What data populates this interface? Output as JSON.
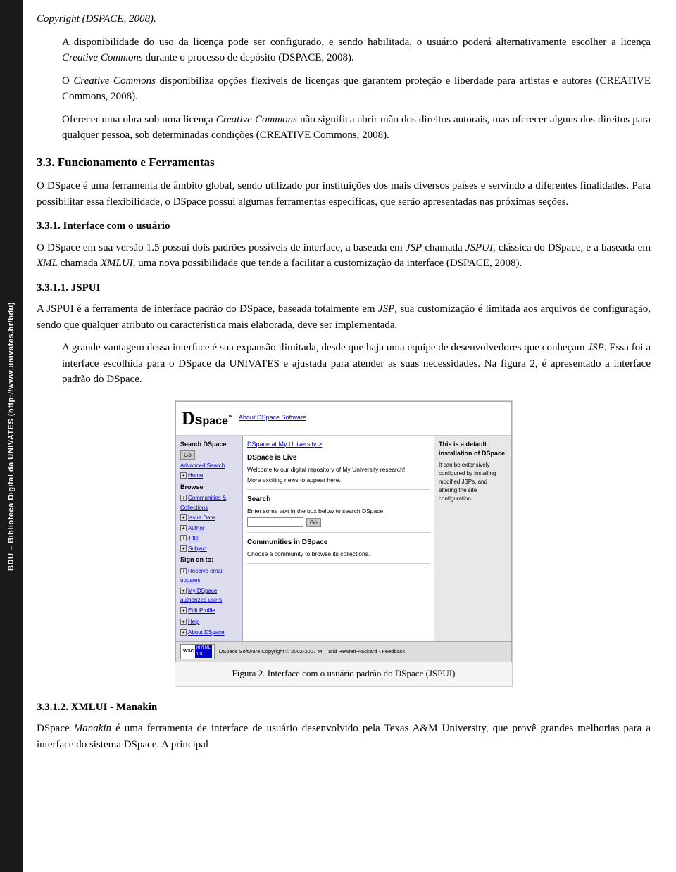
{
  "sidebar": {
    "text": "BDU – Biblioteca Digital da UNIVATES (http://www.univates.br/bdu)"
  },
  "content": {
    "copyright_line": "Copyright (DSPACE, 2008).",
    "paragraph1": "A disponibilidade do uso da licença pode ser configurado, e sendo habilitada, o usuário poderá alternativamente escolher a licença Creative Commons durante o processo de depósito (DSPACE, 2008).",
    "paragraph2": "O Creative Commons disponibiliza opções flexíveis de licenças que garantem proteção e liberdade para artistas e autores (CREATIVE Commons, 2008).",
    "paragraph3": "Oferecer uma obra sob uma licença Creative Commons não significa abrir mão dos direitos autorais, mas oferecer alguns dos direitos para qualquer pessoa, sob determinadas condições (CREATIVE Commons, 2008).",
    "section_heading": "3.3. Funcionamento e Ferramentas",
    "section_para1": "O DSpace é uma ferramenta de âmbito global, sendo utilizado por instituições dos mais diversos países e servindo a diferentes finalidades. Para possibilitar essa flexibilidade, o DSpace possui algumas ferramentas específicas, que serão apresentadas nas próximas seções.",
    "subsection_heading": "3.3.1. Interface com o usuário",
    "subsection_para1": "O DSpace em sua versão 1.5 possui dois padrões possíveis de interface, a baseada em JSP chamada JSPUI, clássica do DSpace, e a baseada em XML chamada XMLUI, uma nova possibilidade que tende a facilitar a customização da interface (DSPACE, 2008).",
    "sub2_heading": "3.3.1.1. JSPUI",
    "sub2_para1": "A JSPUI é a ferramenta de interface padrão do DSpace, baseada totalmente em JSP, sua customização é limitada aos arquivos de configuração, sendo que qualquer atributo ou característica mais elaborada, deve ser implementada.",
    "sub2_para2": "A grande vantagem dessa interface é sua expansão ilimitada, desde que haja uma equipe de desenvolvedores que conheçam JSP. Essa foi a interface escolhida para o DSpace da UNIVATES e ajustada para atender as suas necessidades. Na figura 2, é apresentado a interface padrão do DSpace.",
    "figure_caption": "Figura 2. Interface com o usuário padrão do DSpace (JSPUI)",
    "sub3_heading": "3.3.1.2. XMLUI - Manakin",
    "sub3_para1": "DSpace Manakin é uma ferramenta de interface de usuário desenvolvido pela Texas A&M University, que provê grandes melhorias para a interface do sistema DSpace. A principal"
  },
  "dspace_ui": {
    "logo": "DSpace",
    "logo_d": "D",
    "logo_rest": "Space",
    "logo_tm": "™",
    "nav_link": "About DSpace Software",
    "sidebar": {
      "search_title": "Search DSpace",
      "go_btn": "Go",
      "advanced_link": "Advanced Search",
      "home_link": "Home",
      "browse_title": "Browse",
      "communities_link": "Communities & Collections",
      "issue_link": "Issue Date",
      "author_link": "Author",
      "title_link": "Title",
      "subject_link": "Subject",
      "signon_title": "Sign on to:",
      "receive_link": "Receive email updates",
      "mydspace_link": "My DSpace authorized users",
      "editprofile_link": "Edit Profile",
      "help_link": "Help",
      "about_link": "About DSpace"
    },
    "main": {
      "breadcrumb": "DSpace at My University >",
      "section1_title": "DSpace is Live",
      "section1_para1": "Welcome to our digital repository of My University research!",
      "section1_para2": "More exciting news to appear here.",
      "search_title": "Search",
      "search_para": "Enter some text in the box below to search DSpace.",
      "search_go": "Go",
      "communities_title": "Communities in DSpace",
      "communities_para": "Choose a community to browse its collections."
    },
    "right": {
      "highlight": "This is a default installation of DSpace!",
      "description": "It can be extensively configured by installing modified JSPs, and altering the site configuration."
    },
    "footer": {
      "copyright": "DSpace Software Copyright © 2002-2007 MIT and Hewlett-Packard - Feedback",
      "wsc_label": "W3C XHTML 1.0"
    }
  }
}
